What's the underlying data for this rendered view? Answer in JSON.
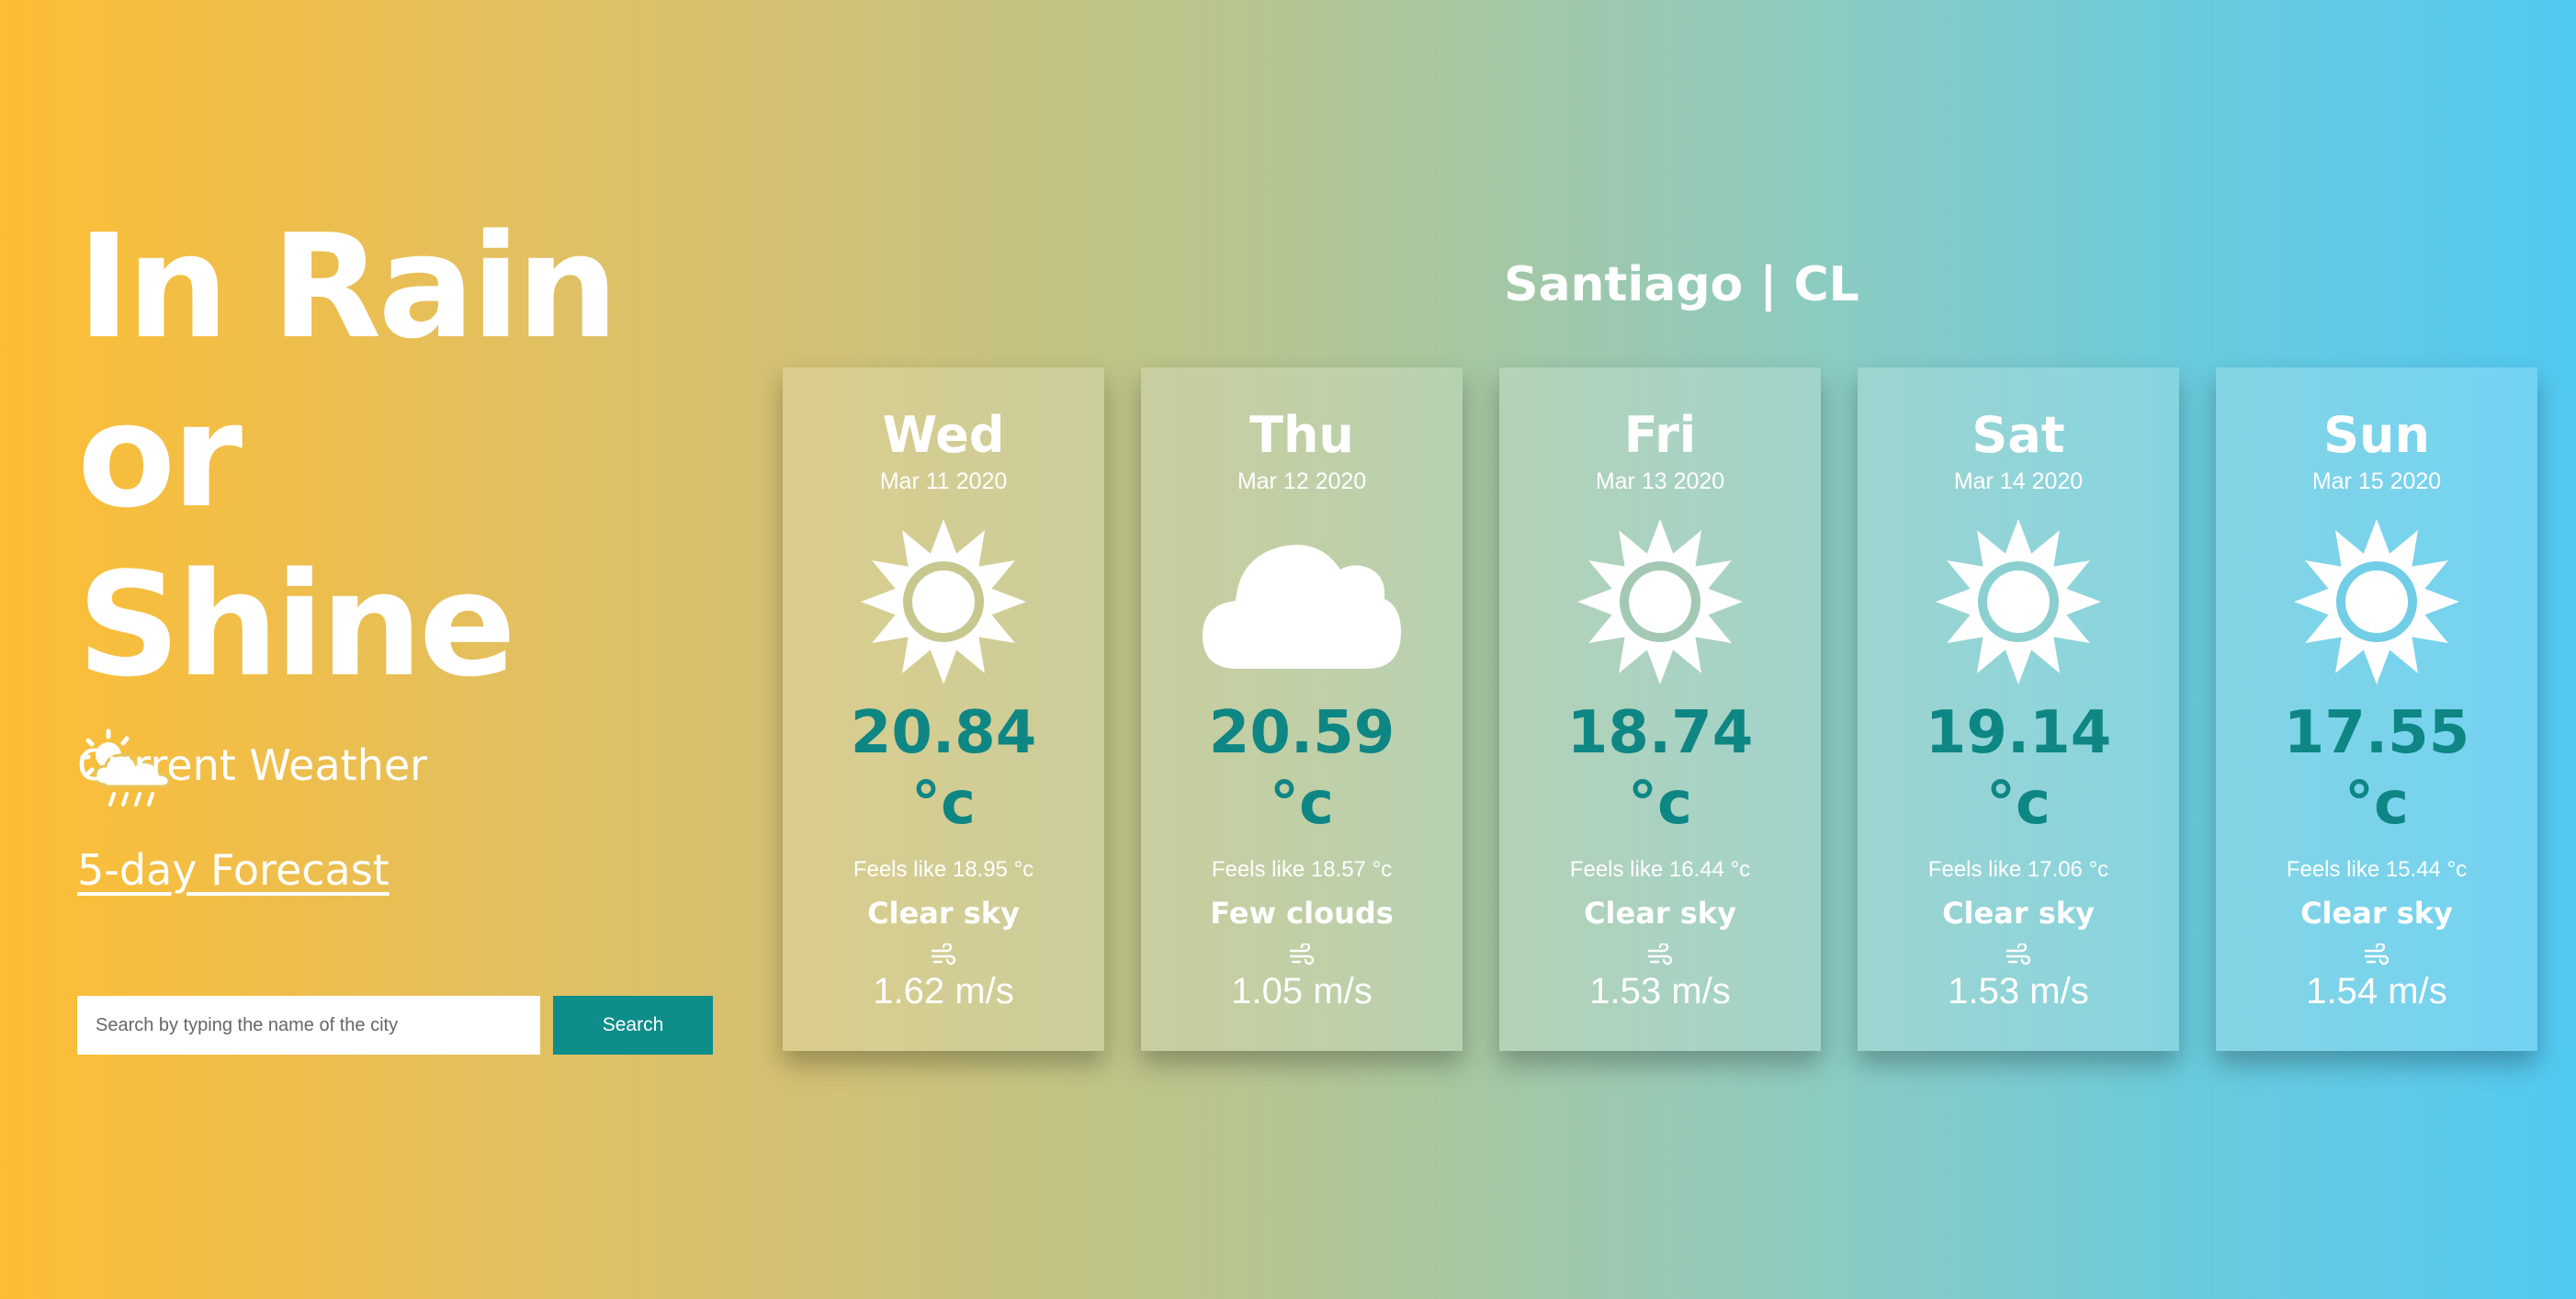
{
  "hero": {
    "title_line1": "In Rain or",
    "title_line2": "Shine",
    "logo_icon": "sun-cloud-rain-icon"
  },
  "nav": {
    "current_weather": "Current Weather",
    "forecast": "5-day Forecast"
  },
  "search": {
    "placeholder": "Search by typing the name of the city",
    "value": "",
    "button_label": "Search"
  },
  "location": {
    "city": "Santiago | CL"
  },
  "colors": {
    "accent": "#0e8e8a",
    "temperature": "#0e8684",
    "gradient_start": "#fdbd34",
    "gradient_end": "#52c9f2"
  },
  "forecast": [
    {
      "day": "Wed",
      "date": "Mar 11 2020",
      "icon": "sun-icon",
      "temp": "20.84",
      "unit": "°c",
      "feels": "Feels like 18.95 °c",
      "desc": "Clear sky",
      "wind": "1.62 m/s"
    },
    {
      "day": "Thu",
      "date": "Mar 12 2020",
      "icon": "cloud-icon",
      "temp": "20.59",
      "unit": "°c",
      "feels": "Feels like 18.57 °c",
      "desc": "Few clouds",
      "wind": "1.05 m/s"
    },
    {
      "day": "Fri",
      "date": "Mar 13 2020",
      "icon": "sun-icon",
      "temp": "18.74",
      "unit": "°c",
      "feels": "Feels like 16.44 °c",
      "desc": "Clear sky",
      "wind": "1.53 m/s"
    },
    {
      "day": "Sat",
      "date": "Mar 14 2020",
      "icon": "sun-icon",
      "temp": "19.14",
      "unit": "°c",
      "feels": "Feels like 17.06 °c",
      "desc": "Clear sky",
      "wind": "1.53 m/s"
    },
    {
      "day": "Sun",
      "date": "Mar 15 2020",
      "icon": "sun-icon",
      "temp": "17.55",
      "unit": "°c",
      "feels": "Feels like 15.44 °c",
      "desc": "Clear sky",
      "wind": "1.54 m/s"
    }
  ]
}
